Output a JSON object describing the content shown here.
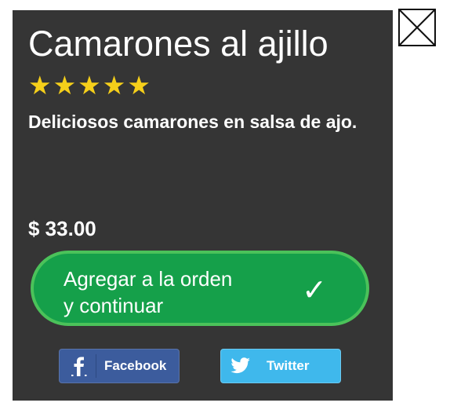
{
  "dish": {
    "title": "Camarones al ajillo",
    "rating_stars": 5,
    "stars_text": "★★★★★",
    "description": "Deliciosos camarones en salsa de ajo.",
    "price": "$ 33.00"
  },
  "order_button": {
    "label_line1": "Agregar a la orden",
    "label_line2": "y continuar",
    "icon": "checkmark-icon",
    "check_glyph": "✓"
  },
  "share": {
    "facebook_label": "Facebook",
    "facebook_icon": "facebook-icon",
    "twitter_label": "Twitter",
    "twitter_icon": "twitter-icon"
  },
  "close_icon": "close-icon",
  "colors": {
    "card_background": "#353535",
    "star": "#f5cf1a",
    "order_button": "#15a04a",
    "order_button_border": "#4bc25a",
    "facebook": "#3c5c9d",
    "twitter": "#3fb8ec"
  }
}
